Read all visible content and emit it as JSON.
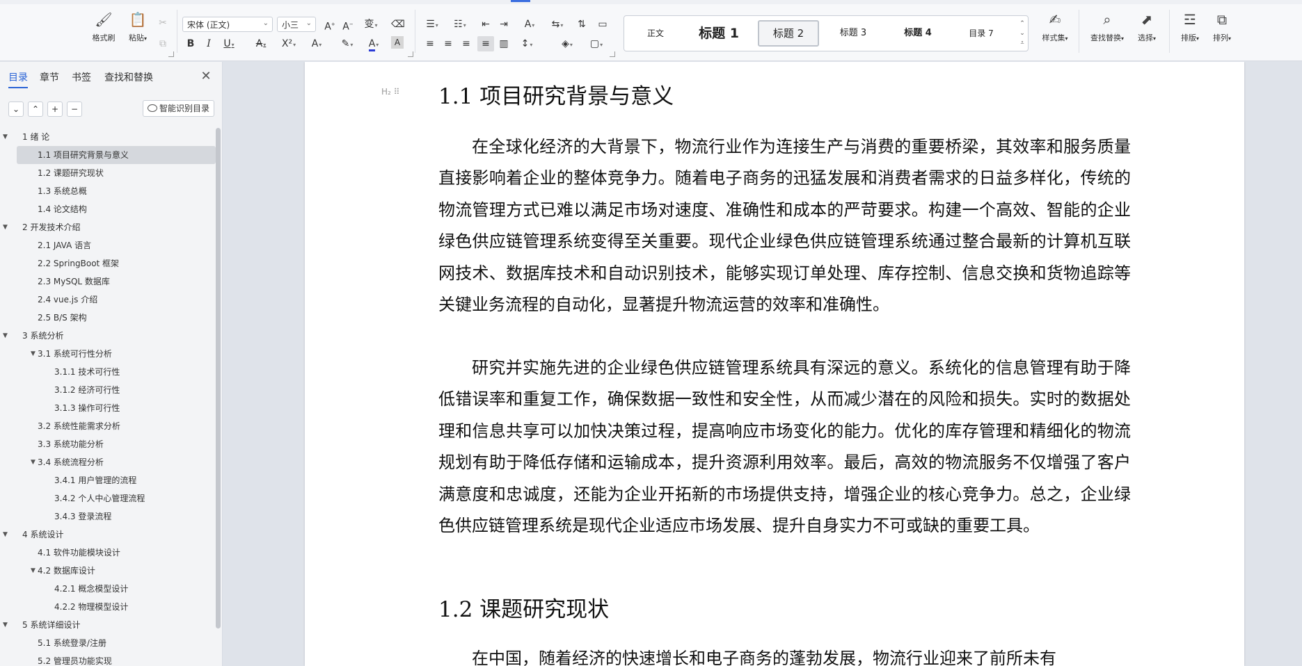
{
  "ribbon": {
    "clipboard": {
      "format_painter": "格式刷",
      "paste": "粘贴"
    },
    "font": {
      "name": "宋体 (正文)",
      "size": "小三"
    },
    "styles": [
      "正文",
      "标题 1",
      "标题 2",
      "标题 3",
      "标题 4",
      "目录 7"
    ],
    "selected_style": "标题 2",
    "style_set": "样式集",
    "find_replace": "查找替换",
    "select": "选择",
    "layout": "排版",
    "arrange": "排列"
  },
  "nav": {
    "tabs": [
      "目录",
      "章节",
      "书签",
      "查找和替换"
    ],
    "active_tab": "目录",
    "smart_detect": "智能识别目录",
    "toc": [
      {
        "label": "1 绪  论",
        "level": 1,
        "expanded": true
      },
      {
        "label": "1.1 项目研究背景与意义",
        "level": 2,
        "selected": true
      },
      {
        "label": "1.2 课题研究现状",
        "level": 2
      },
      {
        "label": "1.3 系统总概",
        "level": 2
      },
      {
        "label": "1.4 论文结构",
        "level": 2
      },
      {
        "label": "2 开发技术介绍",
        "level": 1,
        "expanded": true
      },
      {
        "label": "2.1 JAVA 语言",
        "level": 2
      },
      {
        "label": "2.2 SpringBoot 框架",
        "level": 2
      },
      {
        "label": "2.3 MySQL 数据库",
        "level": 2
      },
      {
        "label": "2.4 vue.js 介绍",
        "level": 2
      },
      {
        "label": "2.5 B/S 架构",
        "level": 2
      },
      {
        "label": "3  系统分析",
        "level": 1,
        "expanded": true
      },
      {
        "label": "3.1 系统可行性分析",
        "level": 2,
        "expanded": true
      },
      {
        "label": "3.1.1 技术可行性",
        "level": 3
      },
      {
        "label": "3.1.2 经济可行性",
        "level": 3
      },
      {
        "label": "3.1.3 操作可行性",
        "level": 3
      },
      {
        "label": "3.2 系统性能需求分析",
        "level": 2
      },
      {
        "label": "3.3 系统功能分析",
        "level": 2
      },
      {
        "label": "3.4 系统流程分析",
        "level": 2,
        "expanded": true
      },
      {
        "label": "3.4.1  用户管理的流程",
        "level": 3
      },
      {
        "label": "3.4.2  个人中心管理流程",
        "level": 3
      },
      {
        "label": "3.4.3  登录流程",
        "level": 3
      },
      {
        "label": "4 系统设计",
        "level": 1,
        "expanded": true
      },
      {
        "label": "4.1  软件功能模块设计",
        "level": 2
      },
      {
        "label": "4.2  数据库设计",
        "level": 2,
        "expanded": true
      },
      {
        "label": "4.2.1  概念模型设计",
        "level": 3
      },
      {
        "label": "4.2.2  物理模型设计",
        "level": 3
      },
      {
        "label": "5 系统详细设计",
        "level": 1,
        "expanded": true
      },
      {
        "label": "5.1 系统登录/注册",
        "level": 2
      },
      {
        "label": "5.2 管理员功能实现",
        "level": 2
      }
    ]
  },
  "doc": {
    "heading_marker": "H₂",
    "heading1": "1.1 项目研究背景与意义",
    "para1": "在全球化经济的大背景下，物流行业作为连接生产与消费的重要桥梁，其效率和服务质量直接影响着企业的整体竞争力。随着电子商务的迅猛发展和消费者需求的日益多样化，传统的物流管理方式已难以满足市场对速度、准确性和成本的严苛要求。构建一个高效、智能的企业绿色供应链管理系统变得至关重要。现代企业绿色供应链管理系统通过整合最新的计算机互联网技术、数据库技术和自动识别技术，能够实现订单处理、库存控制、信息交换和货物追踪等关键业务流程的自动化，显著提升物流运营的效率和准确性。",
    "para2": "研究并实施先进的企业绿色供应链管理系统具有深远的意义。系统化的信息管理有助于降低错误率和重复工作，确保数据一致性和安全性，从而减少潜在的风险和损失。实时的数据处理和信息共享可以加快决策过程，提高响应市场变化的能力。优化的库存管理和精细化的物流规划有助于降低存储和运输成本，提升资源利用效率。最后，高效的物流服务不仅增强了客户满意度和忠诚度，还能为企业开拓新的市场提供支持，增强企业的核心竞争力。总之，企业绿色供应链管理系统是现代企业适应市场发展、提升自身实力不可或缺的重要工具。",
    "heading2": "1.2 课题研究现状",
    "para3": "在中国，随着经济的快速增长和电子商务的蓬勃发展，物流行业迎来了前所未有"
  }
}
